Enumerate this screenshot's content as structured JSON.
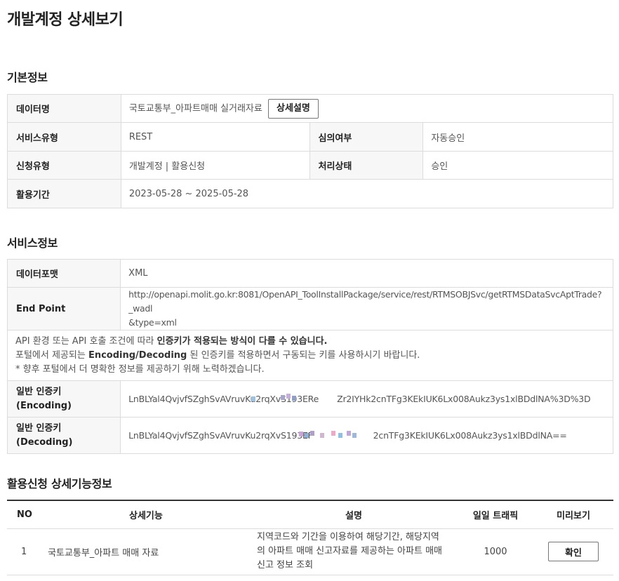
{
  "page_title": "개발계정 상세보기",
  "basic": {
    "section_title": "기본정보",
    "data_name_label": "데이터명",
    "data_name_value": "국토교통부_아파트매매 실거래자료",
    "detail_button": "상세설명",
    "service_type_label": "서비스유형",
    "service_type_value": "REST",
    "review_label": "심의여부",
    "review_value": "자동승인",
    "apply_type_label": "신청유형",
    "apply_type_value": "개발계정 | 활용신청",
    "status_label": "처리상태",
    "status_value": "승인",
    "period_label": "활용기간",
    "period_value": "2023-05-28 ~ 2025-05-28"
  },
  "service": {
    "section_title": "서비스정보",
    "format_label": "데이터포맷",
    "format_value": "XML",
    "endpoint_label": "End Point",
    "endpoint_line1": "http://openapi.molit.go.kr:8081/OpenAPI_ToolInstallPackage/service/rest/RTMSOBJSvc/getRTMSDataSvcAptTrade?_wadl",
    "endpoint_line2": "&type=xml",
    "notice1_a": "API 환경 또는 API 호출 조건에 따라 ",
    "notice1_b": "인증키가 적용되는 방식이 다를 수 있습니다.",
    "notice2_a": "포털에서 제공되는 ",
    "notice2_b": "Encoding/Decoding",
    "notice2_c": " 된 인증키를 적용하면서 구동되는 키를 사용하시기 바랍니다.",
    "notice3": "* 향후 포털에서 더 명확한 정보를 제공하기 위해 노력하겠습니다.",
    "key_enc_label_1": "일반 인증키",
    "key_enc_label_2": "(Encoding)",
    "key_enc_value_a": "LnBLYal4QvjvfSZghSvAVruvKu2rqXvS193ERe",
    "key_enc_value_b": "Zr2IYHk2cnTFg3KEkIUK6Lx008Aukz3ys1xlBDdlNA%3D%3D",
    "key_dec_label_1": "일반 인증키",
    "key_dec_label_2": "(Decoding)",
    "key_dec_value_a": "LnBLYal4QvjvfSZghSvAVruvKu2rqXvS193EF",
    "key_dec_value_b": "2cnTFg3KEkIUK6Lx008Aukz3ys1xlBDdlNA=="
  },
  "functions": {
    "section_title": "활용신청 상세기능정보",
    "headers": [
      "NO",
      "상세기능",
      "설명",
      "일일 트래픽",
      "미리보기"
    ],
    "rows": [
      {
        "no": "1",
        "name": "국토교통부_아파트 매매 자료",
        "desc_line1": "지역코드와 기간을 이용하여 해당기간, 해당지역",
        "desc_line2": "의 아파트 매매 신고자료를 제공하는 아파트 매매",
        "desc_line3": "신고 정보 조회",
        "traffic": "1000",
        "preview_button": "확인"
      }
    ]
  },
  "colors": {
    "border": "#dcdcdc",
    "header_bg": "#f7f7f7",
    "table_top_border": "#333333"
  }
}
